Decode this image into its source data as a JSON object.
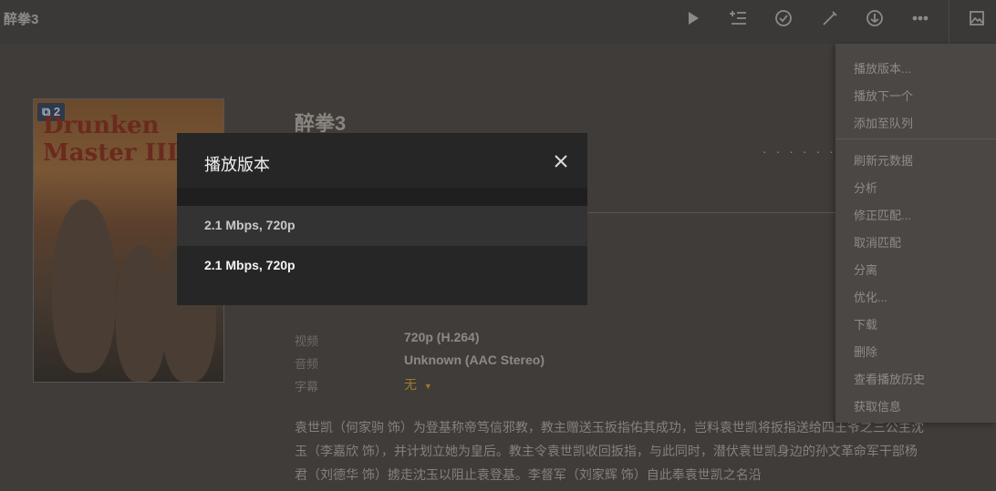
{
  "topbar": {
    "title": "醉拳3",
    "actions": [
      "play-icon",
      "add-to-playlist-icon",
      "check-circle-icon",
      "edit-pencil-icon",
      "download-circle-icon",
      "more-dots-icon",
      "image-icon"
    ]
  },
  "poster": {
    "version_count": "2",
    "art_text": "Drunken Master III"
  },
  "movie": {
    "title": "醉拳3",
    "video_label": "视频",
    "video_value": "720p (H.264)",
    "audio_label": "音频",
    "audio_value": "Unknown (AAC Stereo)",
    "subtitle_label": "字幕",
    "subtitle_value": "无",
    "summary": "袁世凯（何家驹 饰）为登基称帝笃信邪教，教主赠送玉扳指佑其成功，岂料袁世凯将扳指送给四王爷之三公主沈玉（李嘉欣 饰），并计划立她为皇后。教主令袁世凯收回扳指，与此同时，潜伏袁世凯身边的孙文革命军干部杨君（刘德华 饰）掳走沈玉以阻止袁登基。李督军（刘家辉 饰）自此奉袁世凯之名沿"
  },
  "context_menu": {
    "items": [
      "播放版本...",
      "播放下一个",
      "添加至队列",
      "刷新元数据",
      "分析",
      "修正匹配...",
      "取消匹配",
      "分离",
      "优化...",
      "下载",
      "删除",
      "查看播放历史",
      "获取信息"
    ]
  },
  "modal": {
    "title": "播放版本",
    "options": [
      "2.1 Mbps, 720p",
      "2.1 Mbps, 720p"
    ]
  },
  "colors": {
    "modal_bg": "#262626",
    "accent_subtitle": "#9c7a2c"
  }
}
